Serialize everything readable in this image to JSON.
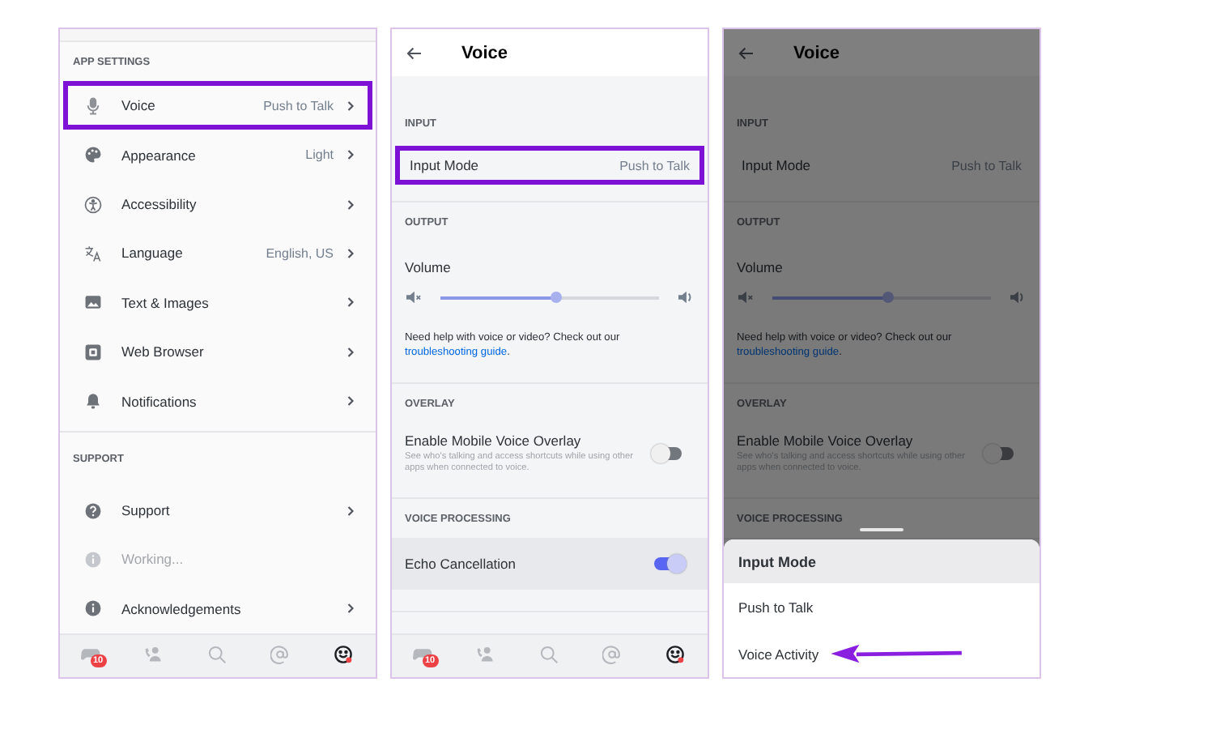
{
  "panels": [
    {
      "kind": "settings",
      "sections": [
        {
          "header": "APP SETTINGS",
          "items": [
            {
              "kind": "mic",
              "label": "Voice",
              "value": "Push to Talk",
              "chevron": true,
              "disabled": false,
              "highlighted": true
            },
            {
              "kind": "palette",
              "label": "Appearance",
              "value": "Light",
              "chevron": true,
              "disabled": false,
              "highlighted": false
            },
            {
              "kind": "accessibility",
              "label": "Accessibility",
              "chevron": true,
              "disabled": false,
              "highlighted": false
            },
            {
              "kind": "language",
              "label": "Language",
              "value": "English, US",
              "chevron": true,
              "disabled": false,
              "highlighted": false
            },
            {
              "kind": "image",
              "label": "Text & Images",
              "chevron": true,
              "disabled": false,
              "highlighted": false
            },
            {
              "kind": "browser",
              "label": "Web Browser",
              "chevron": true,
              "disabled": false,
              "highlighted": false
            },
            {
              "kind": "bell",
              "label": "Notifications",
              "chevron": true,
              "disabled": false,
              "highlighted": false
            }
          ]
        },
        {
          "header": "SUPPORT",
          "items": [
            {
              "kind": "question",
              "label": "Support",
              "chevron": true,
              "disabled": false,
              "highlighted": false
            },
            {
              "kind": "info",
              "label": "Working...",
              "chevron": false,
              "disabled": true,
              "highlighted": false
            },
            {
              "kind": "info",
              "label": "Acknowledgements",
              "chevron": true,
              "disabled": false,
              "highlighted": false
            }
          ]
        }
      ],
      "tabs": [
        {
          "kind": "controller",
          "badge": "10",
          "selected": false
        },
        {
          "kind": "friends",
          "selected": false
        },
        {
          "kind": "search",
          "selected": false
        },
        {
          "kind": "mentions",
          "selected": false
        },
        {
          "kind": "profile",
          "selected": true
        }
      ]
    },
    {
      "kind": "voice",
      "title": "Voice",
      "dimmed": false,
      "sections": [
        {
          "header": "INPUT",
          "rows": [
            {
              "kind": "value",
              "label": "Input Mode",
              "value": "Push to Talk",
              "highlighted": true
            }
          ]
        },
        {
          "header": "OUTPUT",
          "rows": [
            {
              "kind": "slider",
              "label": "Volume",
              "level": 0.53
            },
            {
              "kind": "help",
              "text": "Need help with voice or video? Check out our",
              "link": "troubleshooting guide",
              "tail": "."
            }
          ]
        },
        {
          "header": "OVERLAY",
          "rows": [
            {
              "kind": "toggle",
              "label": "Enable Mobile Voice Overlay",
              "description": "See who's talking and access shortcuts while using other apps when connected to voice.",
              "on": false,
              "pressed": false
            }
          ]
        },
        {
          "header": "VOICE PROCESSING",
          "rows": [
            {
              "kind": "toggle",
              "label": "Echo Cancellation",
              "on": true,
              "pressed": true
            }
          ]
        }
      ],
      "tabs": [
        {
          "kind": "controller",
          "badge": "10",
          "selected": false
        },
        {
          "kind": "friends",
          "selected": false
        },
        {
          "kind": "search",
          "selected": false
        },
        {
          "kind": "mentions",
          "selected": false
        },
        {
          "kind": "profile",
          "selected": true
        }
      ]
    },
    {
      "kind": "voice",
      "title": "Voice",
      "dimmed": true,
      "sections": [
        {
          "header": "INPUT",
          "rows": [
            {
              "kind": "value",
              "label": "Input Mode",
              "value": "Push to Talk",
              "highlighted": false
            }
          ]
        },
        {
          "header": "OUTPUT",
          "rows": [
            {
              "kind": "slider",
              "label": "Volume",
              "level": 0.53
            },
            {
              "kind": "help",
              "text": "Need help with voice or video? Check out our",
              "link": "troubleshooting guide",
              "tail": "."
            }
          ]
        },
        {
          "header": "OVERLAY",
          "rows": [
            {
              "kind": "toggle",
              "label": "Enable Mobile Voice Overlay",
              "description": "See who's talking and access shortcuts while using other apps when connected to voice.",
              "on": false,
              "pressed": false
            }
          ]
        },
        {
          "header": "VOICE PROCESSING"
        }
      ],
      "sheet": {
        "title": "Input Mode",
        "options": [
          {
            "label": "Push to Talk",
            "annotated": false
          },
          {
            "label": "Voice Activity",
            "annotated": true
          }
        ]
      }
    }
  ]
}
